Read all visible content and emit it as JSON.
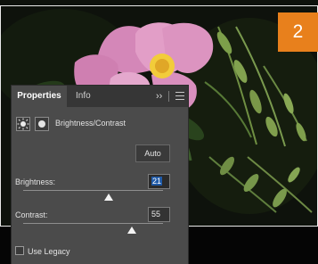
{
  "step_badge": "2",
  "properties_panel": {
    "tabs": [
      "Properties",
      "Info"
    ],
    "collapse_icon": "double-chevron-right-icon",
    "menu_icon": "panel-menu-icon",
    "adjustment_title": "Brightness/Contrast",
    "adjustment_icons": [
      "sun-icon",
      "layer-mask-icon"
    ],
    "auto_label": "Auto",
    "brightness": {
      "label": "Brightness:",
      "value": "21",
      "slider_level": 0.61
    },
    "contrast": {
      "label": "Contrast:",
      "value": "55",
      "slider_level": 0.78
    },
    "use_legacy_label": "Use Legacy",
    "use_legacy_checked": false
  },
  "colors": {
    "panel_bg": "#4b4b4b",
    "tabbar_bg": "#363636",
    "badge_orange": "#e8801c",
    "selection_blue": "#1f5aa8"
  }
}
